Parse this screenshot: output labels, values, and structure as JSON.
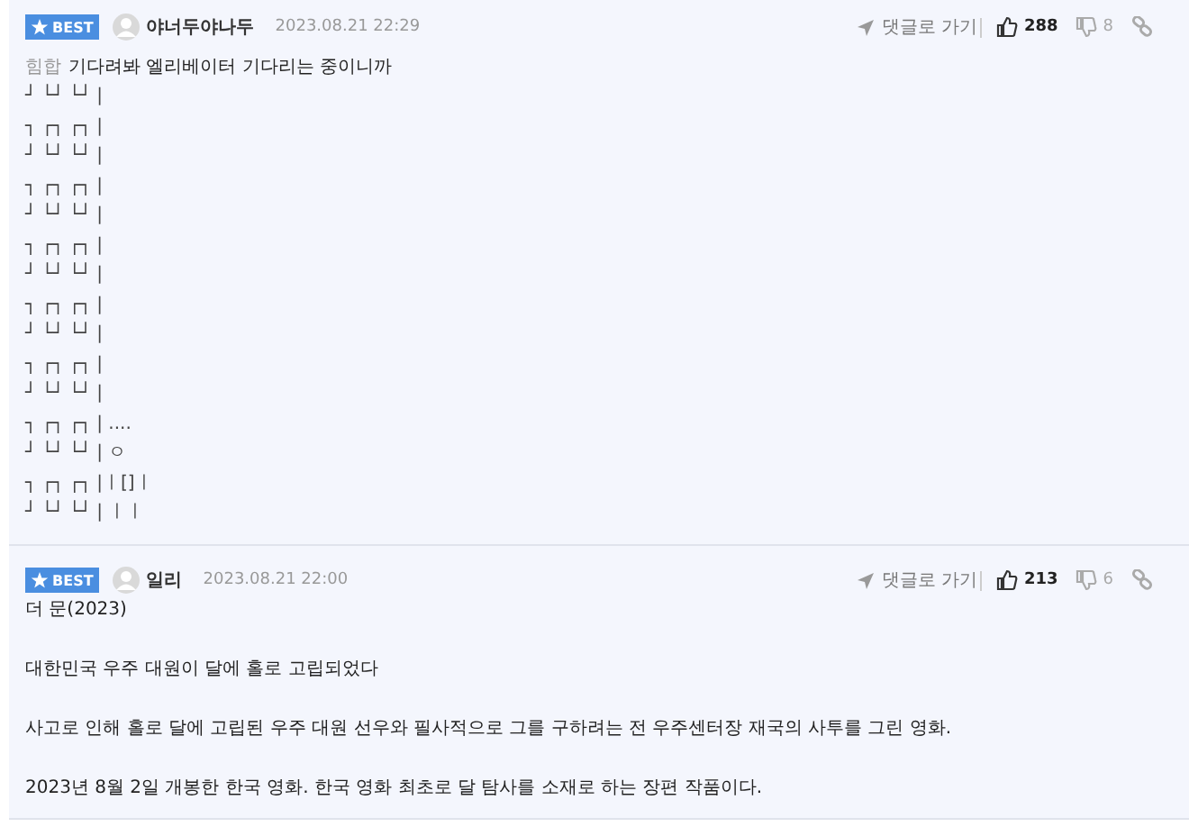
{
  "comments": [
    {
      "badge": "BEST",
      "nickname": "야너두야나두",
      "date": "2023.08.21 22:29",
      "reply_link": "댓글로 가기",
      "likes": "288",
      "dislikes": "8",
      "body": [
        {
          "kind": "text",
          "prefix": "힘합",
          "text": "기다려봐 엘리베이터 기다리는 중이니까"
        },
        {
          "kind": "art",
          "blocks": [
            [
              "┘ └┘ └┘ |"
            ],
            [
              "┐ ┌┐ ┌┐ |",
              "┘ └┘ └┘ |"
            ],
            [
              "┐ ┌┐ ┌┐ |",
              "┘ └┘ └┘ |"
            ],
            [
              "┐ ┌┐ ┌┐ |",
              "┘ └┘ └┘ |"
            ],
            [
              "┐ ┌┐ ┌┐ |",
              "┘ └┘ └┘ |"
            ],
            [
              "┐ ┌┐ ┌┐ |",
              "┘ └┘ └┘ |"
            ],
            [
              "┐ ┌┐ ┌┐ | ....",
              "┘ └┘ └┘ | ㅇ"
            ],
            [
              "┐ ┌┐ ┌┐ |ㅣ[]ㅣ",
              "┘ └┘ └┘ | ㅣㅣ"
            ]
          ]
        }
      ]
    },
    {
      "badge": "BEST",
      "nickname": "일리",
      "date": "2023.08.21 22:00",
      "reply_link": "댓글로 가기",
      "likes": "213",
      "dislikes": "6",
      "body": [
        {
          "kind": "text",
          "text": "더 문(2023)"
        },
        {
          "kind": "text",
          "text": "대한민국 우주 대원이 달에 홀로 고립되었다"
        },
        {
          "kind": "text",
          "text": "사고로 인해 홀로 달에 고립된 우주 대원 선우와 필사적으로 그를 구하려는 전 우주센터장 재국의 사투를 그린 영화."
        },
        {
          "kind": "text",
          "text": "2023년 8월 2일 개봉한 한국 영화. 한국 영화 최초로 달 탐사를 소재로 하는 장편 작품이다."
        }
      ]
    }
  ]
}
